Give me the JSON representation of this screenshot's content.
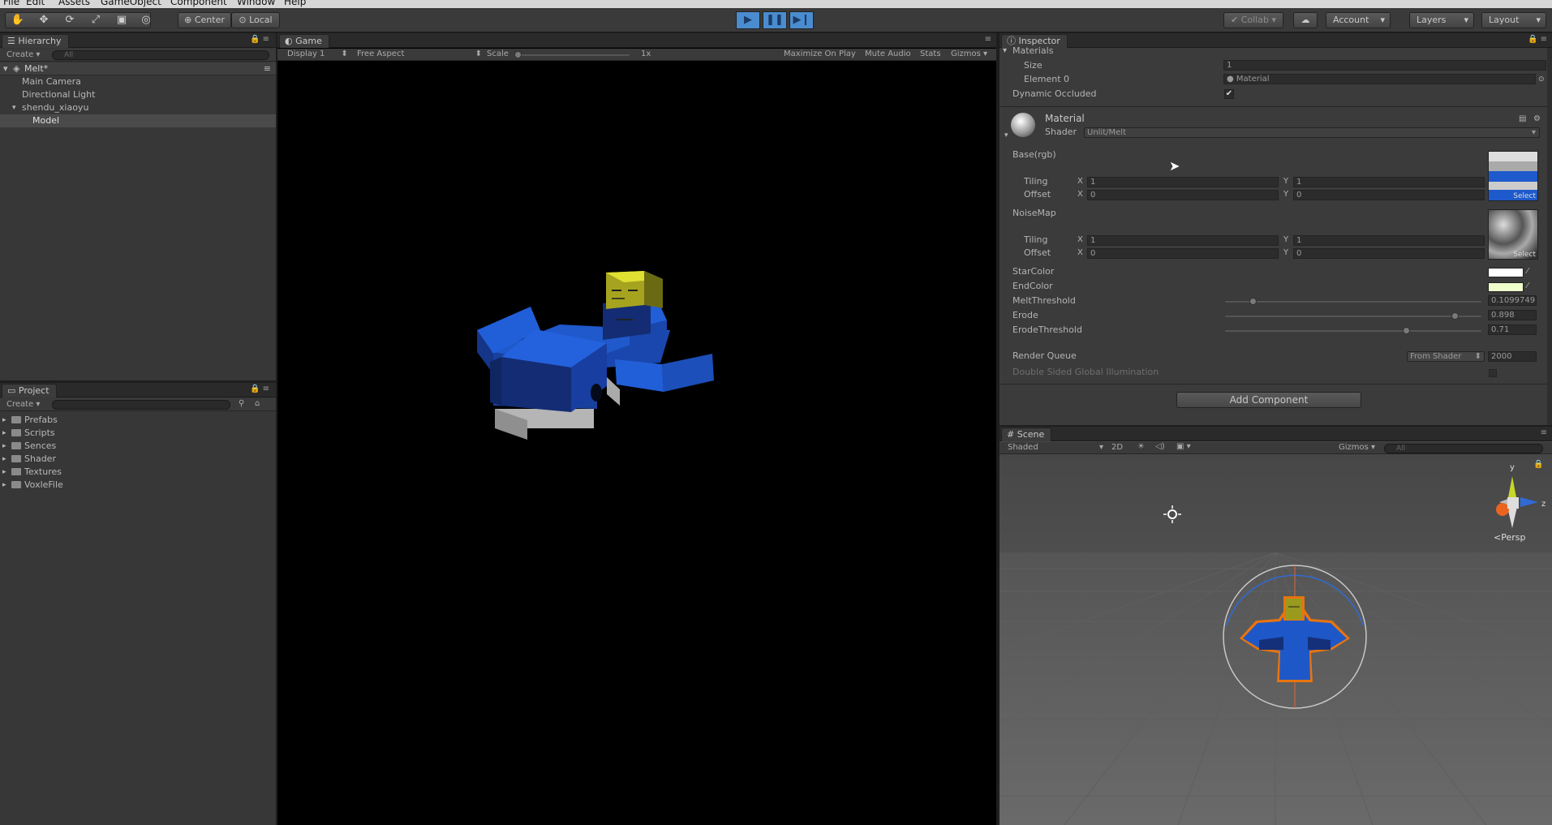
{
  "menu": [
    "File",
    "Edit",
    "Assets",
    "GameObject",
    "Component",
    "Window",
    "Help"
  ],
  "toolbar": {
    "pivot": "Center",
    "space": "Local",
    "collab": "Collab",
    "account": "Account",
    "layers": "Layers",
    "layout": "Layout"
  },
  "hierarchy": {
    "tab": "Hierarchy",
    "create": "Create",
    "search_placeholder": "All",
    "scene": "Melt*",
    "items": [
      "Main Camera",
      "Directional Light",
      "shendu_xiaoyu",
      "Model"
    ]
  },
  "project": {
    "tab": "Project",
    "create": "Create",
    "folders": [
      "Prefabs",
      "Scripts",
      "Sences",
      "Shader",
      "Textures",
      "VoxleFile"
    ]
  },
  "game": {
    "tab": "Game",
    "display": "Display 1",
    "aspect": "Free Aspect",
    "scale_label": "Scale",
    "scale_value": "1x",
    "maximize": "Maximize On Play",
    "mute": "Mute Audio",
    "stats": "Stats",
    "gizmos": "Gizmos"
  },
  "inspector": {
    "tab": "Inspector",
    "materials_label": "Materials",
    "size_label": "Size",
    "size_value": "1",
    "element0_label": "Element 0",
    "element0_value": "Material",
    "dynamic_occluded": "Dynamic Occluded",
    "material_name": "Material",
    "shader_label": "Shader",
    "shader_value": "Unlit/Melt",
    "base_label": "Base(rgb)",
    "noise_label": "NoiseMap",
    "tiling": "Tiling",
    "offset": "Offset",
    "x": "X",
    "y": "Y",
    "base_tiling_x": "1",
    "base_tiling_y": "1",
    "base_offset_x": "0",
    "base_offset_y": "0",
    "noise_tiling_x": "1",
    "noise_tiling_y": "1",
    "noise_offset_x": "0",
    "noise_offset_y": "0",
    "select": "Select",
    "star_color": "StarColor",
    "end_color": "EndColor",
    "melt_threshold": "MeltThreshold",
    "melt_threshold_value": "0.1099749",
    "erode": "Erode",
    "erode_value": "0.898",
    "erode_threshold": "ErodeThreshold",
    "erode_threshold_value": "0.71",
    "render_queue": "Render Queue",
    "render_queue_mode": "From Shader",
    "render_queue_value": "2000",
    "double_sided": "Double Sided Global Illumination",
    "add_component": "Add Component",
    "melt_level": 0.11,
    "erode_level": 0.898,
    "erode_threshold_level": 0.71
  },
  "scene": {
    "tab": "Scene",
    "shading": "Shaded",
    "mode_2d": "2D",
    "gizmos": "Gizmos",
    "search_placeholder": "All",
    "persp": "Persp",
    "axis_y": "y",
    "axis_z": "z"
  },
  "colors": {
    "editor_bg": "#373737",
    "play_active": "#4a8ccf",
    "model_blue": "#1e5acc",
    "model_yellow": "#a6a41e",
    "selection_orange": "#e8740f"
  }
}
